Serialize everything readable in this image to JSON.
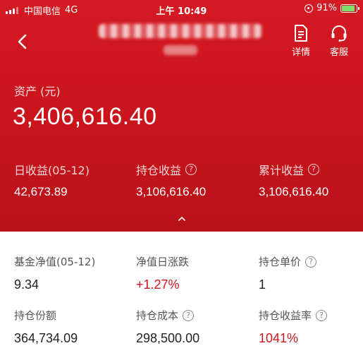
{
  "status_bar": {
    "carrier": "中国电信",
    "network": "4G",
    "time": "上午 10:49",
    "battery": "91%",
    "battery_level": 0.91
  },
  "nav": {
    "detail_label": "详情",
    "service_label": "客服"
  },
  "summary": {
    "asset_label": "资产 (元)",
    "asset_value": "3,406,616.40",
    "stats": [
      {
        "label": "日收益(05-12)",
        "value": "42,673.89"
      },
      {
        "label": "持仓收益",
        "value": "3,106,616.40"
      },
      {
        "label": "累计收益",
        "value": "3,106,616.40"
      }
    ]
  },
  "details": {
    "row1": [
      {
        "label": "基金净值(05-12)",
        "value": "9.34"
      },
      {
        "label": "净值日涨跌",
        "value": "+1.27%"
      },
      {
        "label": "持仓单价",
        "value": "1"
      }
    ],
    "row2": [
      {
        "label": "持仓份额",
        "value": "364,734.09"
      },
      {
        "label": "持仓成本",
        "value": "298,500.00"
      },
      {
        "label": "持仓收益率",
        "value": "1041%"
      }
    ]
  },
  "help_glyph": "?",
  "colors": {
    "brand_red": "#c9141c",
    "positive_red": "#d0161f"
  }
}
